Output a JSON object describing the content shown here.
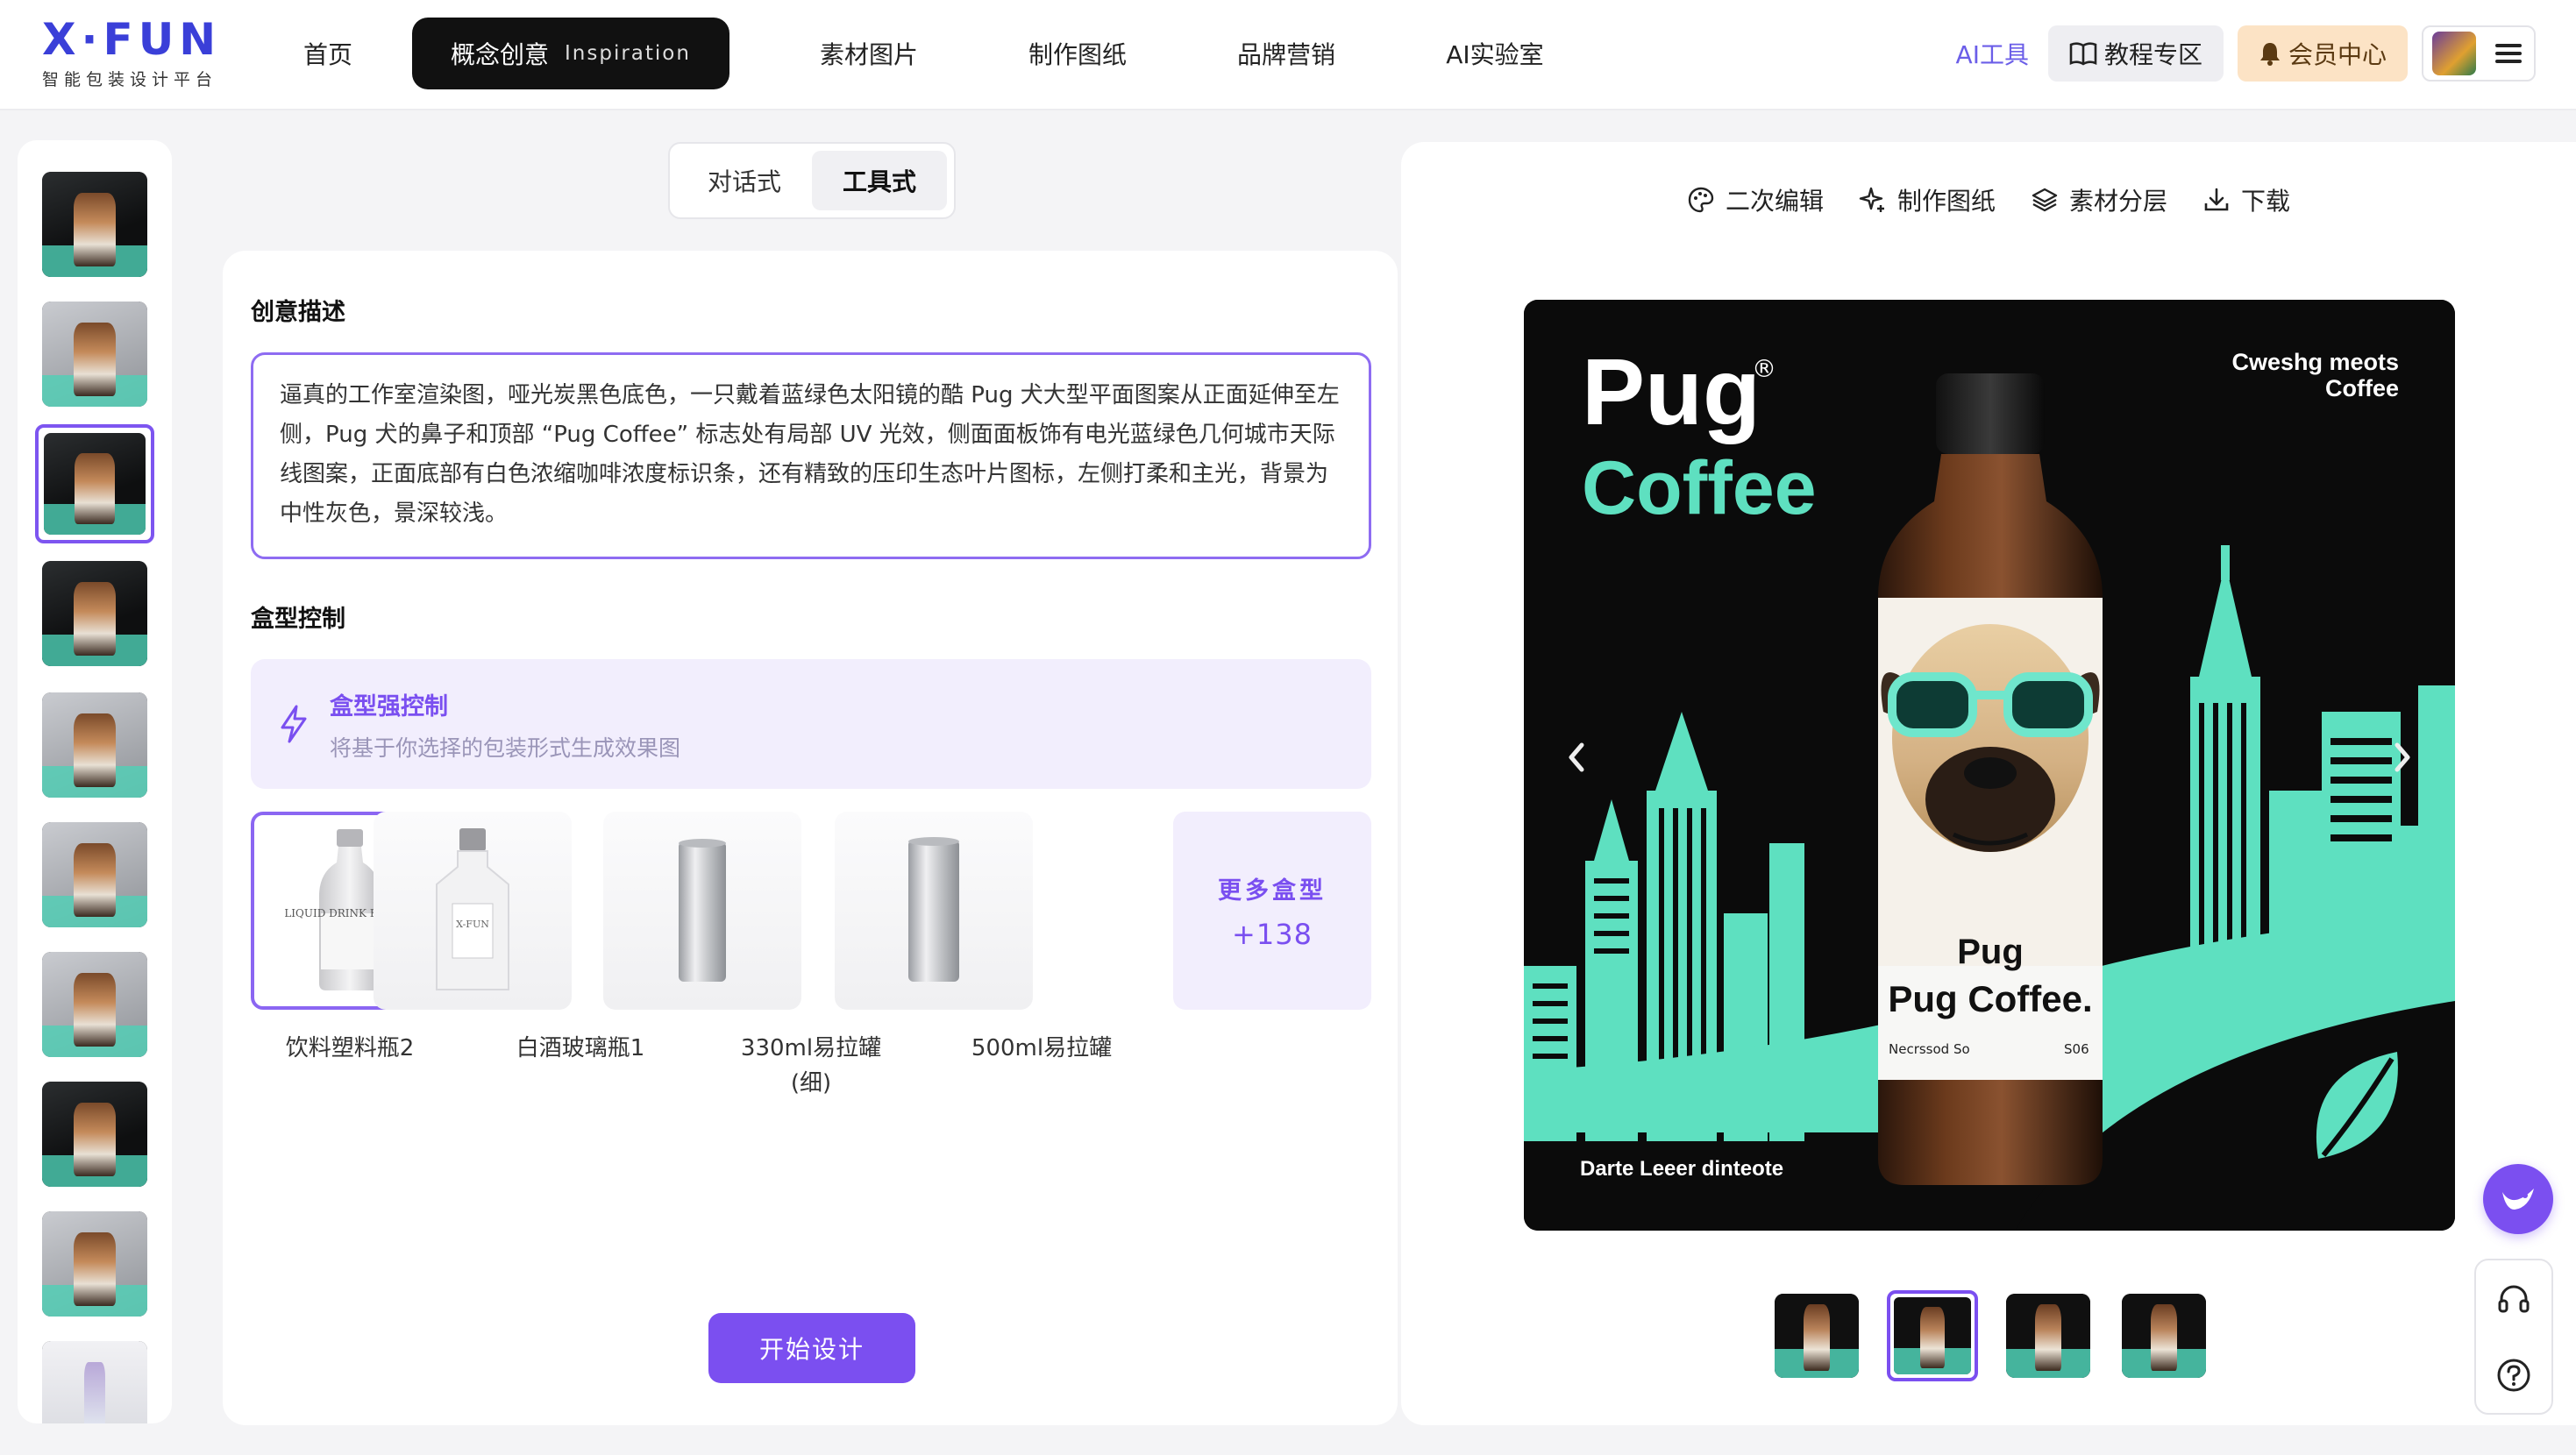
{
  "app": {
    "logo": "X·FUN",
    "tagline": "智能包装设计平台"
  },
  "nav": {
    "items": [
      {
        "label": "首页"
      },
      {
        "label": "概念创意",
        "sub": "Inspiration",
        "active": true
      },
      {
        "label": "素材图片"
      },
      {
        "label": "制作图纸"
      },
      {
        "label": "品牌营销"
      },
      {
        "label": "AI实验室"
      }
    ],
    "ai_tool": "AI工具",
    "tutorial": "教程专区",
    "vip": "会员中心"
  },
  "mode_switch": {
    "options": [
      "对话式",
      "工具式"
    ],
    "selected": "工具式"
  },
  "creative": {
    "title": "创意描述",
    "text": "逼真的工作室渲染图，哑光炭黑色底色，一只戴着蓝绿色太阳镜的酷 Pug 犬大型平面图案从正面延伸至左侧，Pug 犬的鼻子和顶部 “Pug Coffee” 标志处有局部 UV 光效，侧面面板饰有电光蓝绿色几何城市天际线图案，正面底部有白色浓缩咖啡浓度标识条，还有精致的压印生态叶片图标，左侧打柔和主光，背景为中性灰色，景深较浅。"
  },
  "box_control": {
    "title": "盒型控制",
    "strong_title": "盒型强控制",
    "strong_desc": "将基于你选择的包装形式生成效果图",
    "options": [
      {
        "label": "饮料塑料瓶2",
        "bottle_text": "LIQUID DRINK BOTTLE"
      },
      {
        "label": "白酒玻璃瓶1",
        "bottle_text": "X-FUN"
      },
      {
        "label": "330ml易拉罐\n(细)"
      },
      {
        "label": "500ml易拉罐"
      }
    ],
    "selected_index": 0,
    "more_label": "更多盒型",
    "more_count": "+138"
  },
  "start_button": "开始设计",
  "preview": {
    "tools": [
      "二次编辑",
      "制作图纸",
      "素材分层",
      "下载"
    ],
    "brand_top": "Pug",
    "brand_bottom": "Coffee",
    "registered": "®",
    "corner_text_1": "Cweshg meots",
    "corner_text_2": "Coffee",
    "bottle_brand": "Pug",
    "bottle_name": "Pug Coffee.",
    "bottle_small_left": "Necrssod  So",
    "bottle_small_right": "S06",
    "footer_text": "Darte Leeer dinteote",
    "strip_count": 4,
    "strip_selected": 1
  },
  "colors": {
    "accent": "#7b4ff0",
    "teal": "#4fd1b6",
    "dark": "#0c0c0c"
  }
}
